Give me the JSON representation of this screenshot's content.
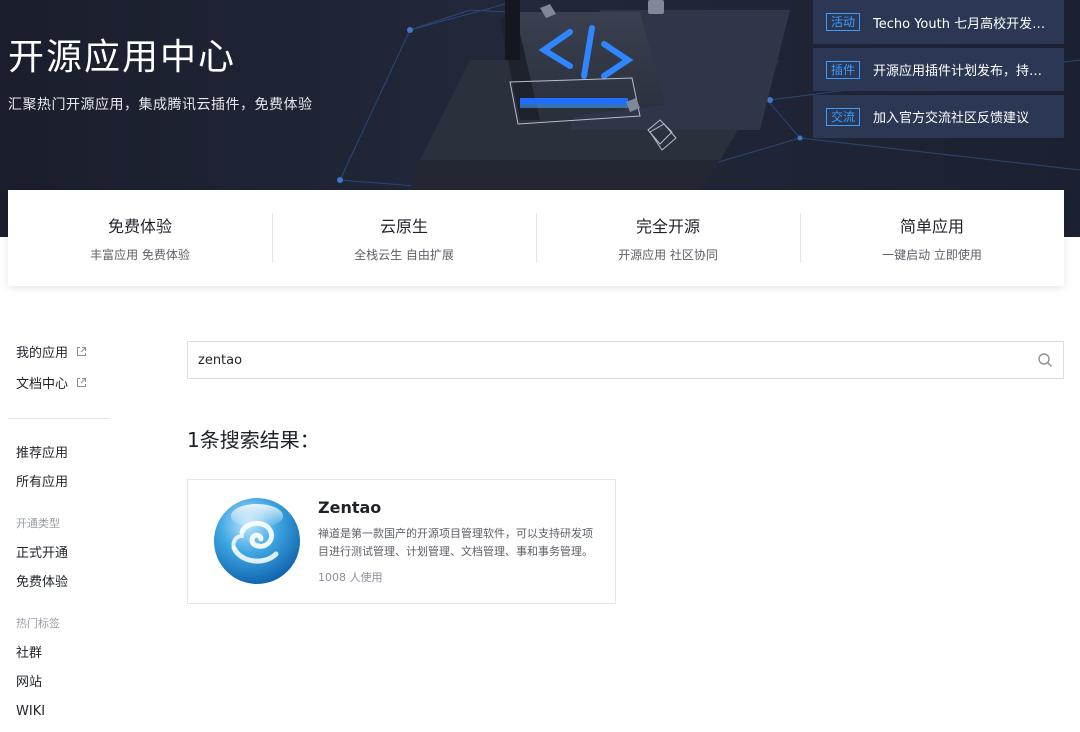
{
  "hero": {
    "title": "开源应用中心",
    "subtitle": "汇聚热门开源应用，集成腾讯云插件，免费体验",
    "news": [
      {
        "tag": "活动",
        "text": "Techo Youth 七月高校开发者..."
      },
      {
        "tag": "插件",
        "text": "开源应用插件计划发布，持续..."
      },
      {
        "tag": "交流",
        "text": "加入官方交流社区反馈建议"
      }
    ]
  },
  "features": [
    {
      "title": "免费体验",
      "desc": "丰富应用 免费体验"
    },
    {
      "title": "云原生",
      "desc": "全栈云生 自由扩展"
    },
    {
      "title": "完全开源",
      "desc": "开源应用 社区协同"
    },
    {
      "title": "简单应用",
      "desc": "一键启动 立即使用"
    }
  ],
  "sidebar": {
    "links": [
      {
        "label": "我的应用"
      },
      {
        "label": "文档中心"
      }
    ],
    "nav": {
      "recommended": "推荐应用",
      "all": "所有应用"
    },
    "open_type": {
      "heading": "开通类型",
      "items": [
        "正式开通",
        "免费体验"
      ]
    },
    "hot_tags": {
      "heading": "热门标签",
      "items": [
        "社群",
        "网站",
        "WIKI"
      ]
    }
  },
  "search": {
    "value": "zentao"
  },
  "results": {
    "count_label": "1条搜索结果：",
    "apps": [
      {
        "name": "Zentao",
        "description": "禅道是第一款国产的开源项目管理软件，可以支持研发项目进行测试管理、计划管理、文档管理、事和事务管理。",
        "users": "1008 人使用"
      }
    ]
  },
  "colors": {
    "hero_bg": "#1b1f2e",
    "accent": "#3d9cff",
    "news_bg": "#2c3a56"
  },
  "icons": {
    "external_link": "external-link-icon",
    "search": "search-icon",
    "app_logo": "zentao-logo"
  }
}
